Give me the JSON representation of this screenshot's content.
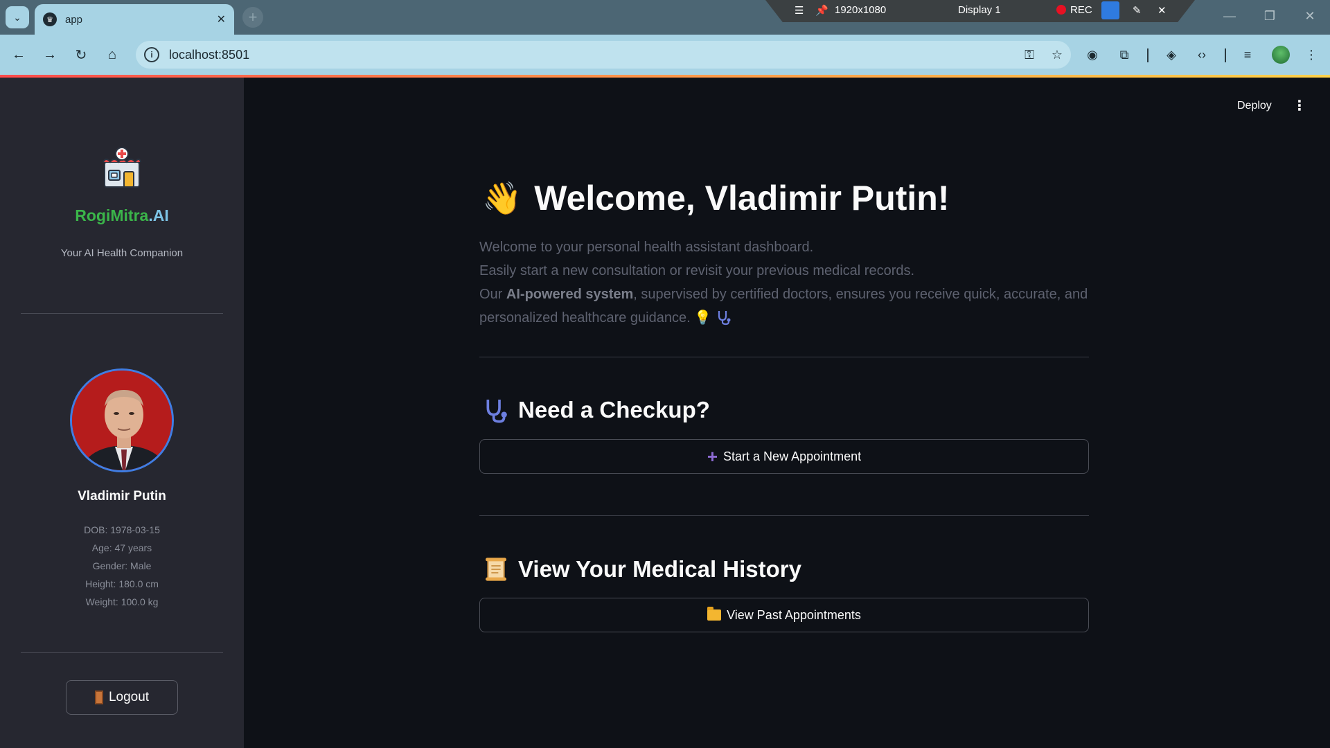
{
  "browser": {
    "tab_title": "app",
    "url": "localhost:8501",
    "recorder": {
      "resolution": "1920x1080",
      "display": "Display 1",
      "rec_label": "REC"
    }
  },
  "sidebar": {
    "brand_part1": "RogiMitra",
    "brand_part2": ".AI",
    "tagline": "Your AI Health Companion",
    "user": {
      "name": "Vladimir Putin",
      "dob": "DOB: 1978-03-15",
      "age": "Age: 47 years",
      "gender": "Gender: Male",
      "height": "Height: 180.0 cm",
      "weight": "Weight: 100.0 kg"
    },
    "logout_label": "Logout"
  },
  "header": {
    "deploy_label": "Deploy",
    "menu_icon": "⋮"
  },
  "main": {
    "welcome_emoji": "👋",
    "welcome_title": "Welcome, Vladimir Putin!",
    "intro_line1": "Welcome to your personal health assistant dashboard.",
    "intro_line2": "Easily start a new consultation or revisit your previous medical records.",
    "intro_line3_pre": "Our ",
    "intro_line3_bold": "AI-powered system",
    "intro_line3_post": ", supervised by certified doctors, ensures you receive quick, accurate, and personalized healthcare guidance.",
    "checkup": {
      "title": "Need a Checkup?",
      "button_label": "Start a New Appointment"
    },
    "history": {
      "title": "View Your Medical History",
      "button_label": "View Past Appointments"
    }
  },
  "colors": {
    "brand_green": "#3bb54a",
    "brand_blue": "#7dc4e6",
    "background": "#0e1117",
    "sidebar": "#262730",
    "accent_bar": "#ff4b4b"
  }
}
